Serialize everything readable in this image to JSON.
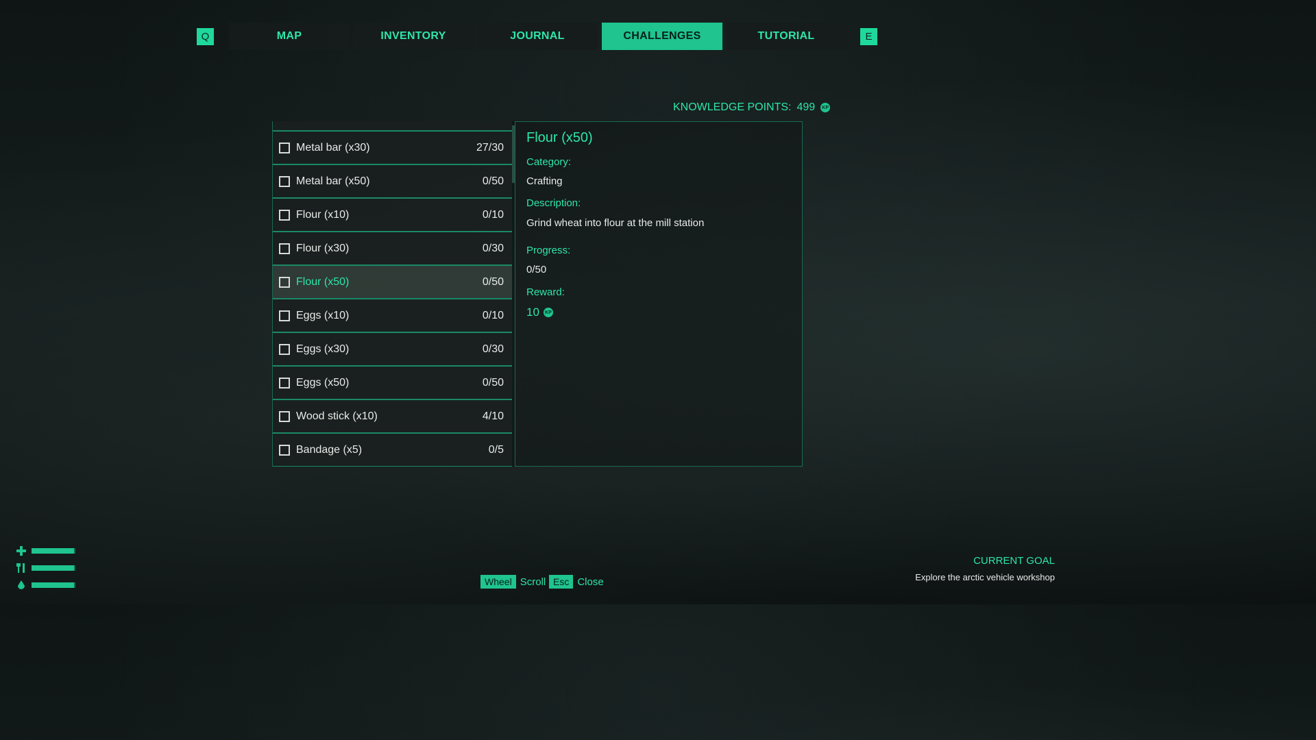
{
  "nav": {
    "prev_key": "Q",
    "next_key": "E",
    "tabs": [
      {
        "label": "MAP",
        "active": false
      },
      {
        "label": "INVENTORY",
        "active": false
      },
      {
        "label": "JOURNAL",
        "active": false
      },
      {
        "label": "CHALLENGES",
        "active": true
      },
      {
        "label": "TUTORIAL",
        "active": false
      }
    ]
  },
  "knowledge": {
    "label": "KNOWLEDGE POINTS:",
    "value": "499",
    "icon": "kp-coin-icon"
  },
  "challenges": [
    {
      "label": "Metal bar (x30)",
      "progress": "27/30",
      "checked": false
    },
    {
      "label": "Metal bar (x50)",
      "progress": "0/50",
      "checked": false
    },
    {
      "label": "Flour (x10)",
      "progress": "0/10",
      "checked": false
    },
    {
      "label": "Flour (x30)",
      "progress": "0/30",
      "checked": false
    },
    {
      "label": "Flour (x50)",
      "progress": "0/50",
      "checked": false,
      "selected": true
    },
    {
      "label": "Eggs (x10)",
      "progress": "0/10",
      "checked": false
    },
    {
      "label": "Eggs (x30)",
      "progress": "0/30",
      "checked": false
    },
    {
      "label": "Eggs (x50)",
      "progress": "0/50",
      "checked": false
    },
    {
      "label": "Wood stick (x10)",
      "progress": "4/10",
      "checked": false
    },
    {
      "label": "Bandage (x5)",
      "progress": "0/5",
      "checked": false
    }
  ],
  "detail": {
    "title": "Flour (x50)",
    "category_label": "Category:",
    "category": "Crafting",
    "description_label": "Description:",
    "description": "Grind wheat into flour at the mill station",
    "progress_label": "Progress:",
    "progress": "0/50",
    "reward_label": "Reward:",
    "reward": "10"
  },
  "hud": {
    "health_icon": "plus-icon",
    "food_icon": "fork-knife-icon",
    "water_icon": "droplet-icon",
    "health": 1.0,
    "food": 1.0,
    "water": 1.0
  },
  "controls": [
    {
      "key": "Wheel",
      "action": "Scroll"
    },
    {
      "key": "Esc",
      "action": "Close"
    }
  ],
  "goal": {
    "title": "CURRENT GOAL",
    "text": "Explore the arctic vehicle workshop"
  },
  "colors": {
    "accent": "#2ee6a8",
    "accent_fill": "#1fc48e",
    "panel": "#1a201f"
  }
}
